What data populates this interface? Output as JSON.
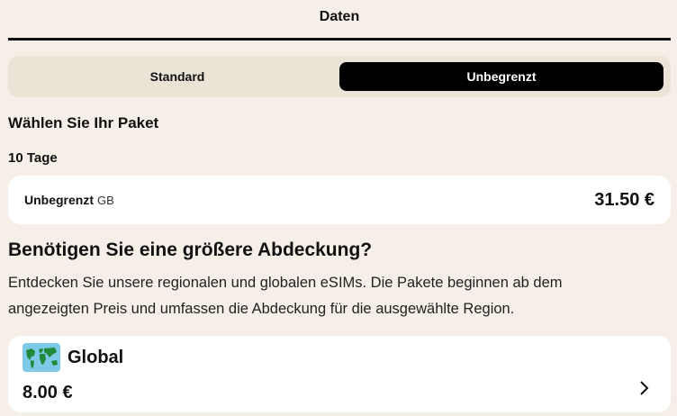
{
  "header": {
    "tab_label": "Daten"
  },
  "plan_toggle": {
    "options": [
      {
        "label": "Standard",
        "active": false
      },
      {
        "label": "Unbegrenzt",
        "active": true
      }
    ]
  },
  "package_section": {
    "heading": "Wählen Sie Ihr Paket",
    "duration_label": "10 Tage",
    "package": {
      "name": "Unbegrenzt",
      "unit": "GB",
      "price": "31.50 €"
    }
  },
  "coverage_section": {
    "heading": "Benötigen Sie eine größere Abdeckung?",
    "description": "Entdecken Sie unsere regionalen und globalen eSIMs. Die Pakete beginnen ab dem angezeigten Preis und umfassen die Abdeckung für die ausgewählte Region.",
    "region_card": {
      "name": "Global",
      "price": "8.00 €",
      "icon": "world-map-icon"
    }
  },
  "colors": {
    "background": "#f5efe7",
    "segment_bg": "#ece3d7",
    "active_bg": "#000000",
    "card_bg": "#ffffff",
    "map_sea": "#7ec8e8",
    "map_land": "#1f8a3a"
  }
}
